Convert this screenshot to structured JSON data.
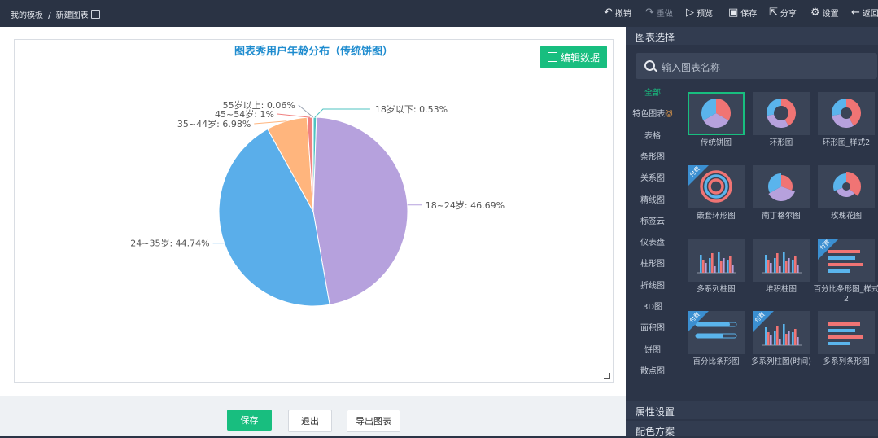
{
  "breadcrumb": {
    "root": "我的模板",
    "separator": "/",
    "current": "新建图表"
  },
  "toolbar": {
    "undo": "撤销",
    "redo": "重做",
    "preview": "预览",
    "save": "保存",
    "share": "分享",
    "settings": "设置",
    "back": "返回"
  },
  "chart": {
    "title": "图表秀用户年龄分布（传统饼图）",
    "edit_data_label": "编辑数据"
  },
  "chart_data": {
    "type": "pie",
    "title": "图表秀用户年龄分布（传统饼图）",
    "slices": [
      {
        "label": "18岁以下",
        "value": 0.53,
        "text": "18岁以下: 0.53%",
        "color": "#4fc3c1"
      },
      {
        "label": "18~24岁",
        "value": 46.69,
        "text": "18~24岁: 46.69%",
        "color": "#b6a1dd"
      },
      {
        "label": "24~35岁",
        "value": 44.74,
        "text": "24~35岁: 44.74%",
        "color": "#5aaeea"
      },
      {
        "label": "35~44岁",
        "value": 6.98,
        "text": "35~44岁: 6.98%",
        "color": "#ffb57d"
      },
      {
        "label": "45~54岁",
        "value": 1,
        "text": "45~54岁: 1%",
        "color": "#f08080"
      },
      {
        "label": "55岁以上",
        "value": 0.06,
        "text": "55岁以上: 0.06%",
        "color": "#a9c46a"
      }
    ]
  },
  "bottom_buttons": {
    "save": "保存",
    "exit": "退出",
    "export": "导出图表"
  },
  "panel": {
    "chart_select_header": "图表选择",
    "search_placeholder": "输入图表名称",
    "categories": [
      "全部",
      "特色图表",
      "表格",
      "条形图",
      "关系图",
      "精线图",
      "标签云",
      "仪表盘",
      "柱形图",
      "折线图",
      "3D图",
      "面积图",
      "饼图",
      "散点图"
    ],
    "featured_emoji": "🐱",
    "tiles": [
      {
        "label": "传统饼图",
        "selected": true,
        "paid": false
      },
      {
        "label": "环形图",
        "paid": false
      },
      {
        "label": "环形图_样式2",
        "paid": false
      },
      {
        "label": "嵌套环形图",
        "paid": true
      },
      {
        "label": "南丁格尔图",
        "paid": false
      },
      {
        "label": "玫瑰花图",
        "paid": false
      },
      {
        "label": "多系列柱图",
        "paid": false
      },
      {
        "label": "堆积柱图",
        "paid": false
      },
      {
        "label": "百分比条形图_样式2",
        "paid": true
      },
      {
        "label": "百分比条形图",
        "paid": true
      },
      {
        "label": "多系列柱图(时间)",
        "paid": true
      },
      {
        "label": "多系列条形图",
        "paid": false
      }
    ],
    "paid_badge": "付费",
    "property_header": "属性设置",
    "color_header": "配色方案"
  }
}
